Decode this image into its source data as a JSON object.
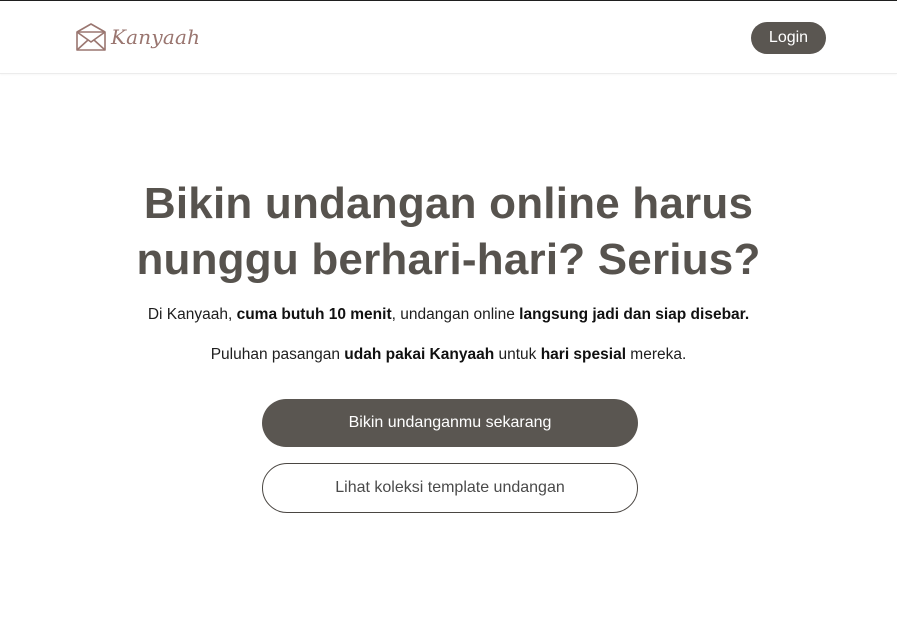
{
  "header": {
    "logo_text": "Kanyaah",
    "login_label": "Login"
  },
  "hero": {
    "title_line1": "Bikin undangan online harus",
    "title_line2": "nunggu berhari-hari? Serius?",
    "sub1": {
      "part1": "Di Kanyaah, ",
      "bold1": "cuma butuh 10 menit",
      "part2": ", undangan online ",
      "bold2": "langsung jadi dan siap disebar."
    },
    "sub2": {
      "part1": "Puluhan pasangan ",
      "bold1": "udah pakai Kanyaah",
      "part2": " untuk ",
      "bold2": "hari spesial",
      "part3": " mereka."
    },
    "primary_cta": "Bikin undanganmu sekarang",
    "secondary_cta": "Lihat koleksi template undangan"
  },
  "colors": {
    "brand_dark": "#5a5651",
    "logo_accent": "#9a7670",
    "title": "#57534e"
  },
  "icons": {
    "logo": "envelope-house-icon"
  }
}
